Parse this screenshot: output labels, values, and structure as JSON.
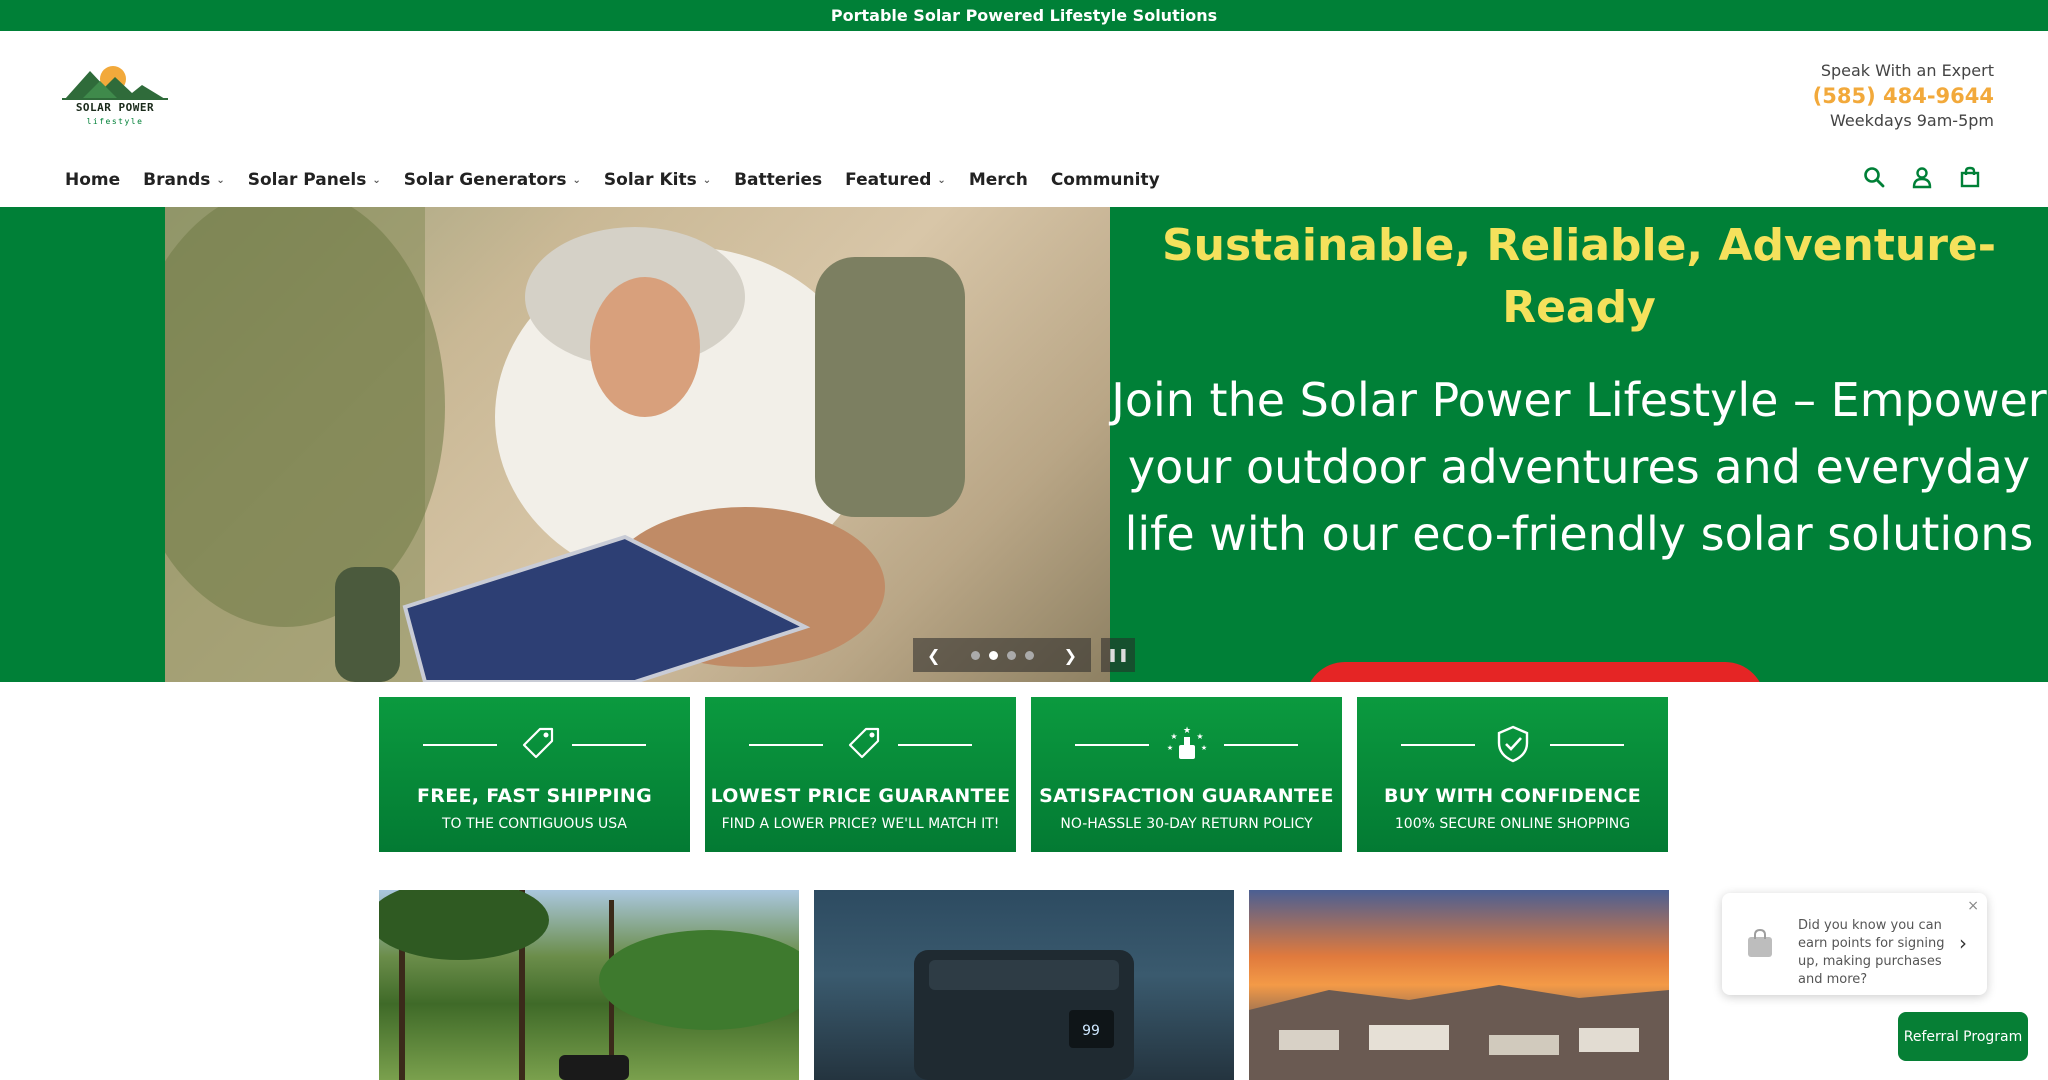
{
  "announcement": {
    "text": "Portable Solar Powered Lifestyle Solutions"
  },
  "logo": {
    "line1": "SOLAR POWER",
    "line2": "lifestyle"
  },
  "contact": {
    "label": "Speak With an Expert",
    "phone": "(585) 484-9644",
    "hours": "Weekdays 9am-5pm"
  },
  "nav": {
    "items": [
      {
        "label": "Home",
        "dropdown": false
      },
      {
        "label": "Brands",
        "dropdown": true
      },
      {
        "label": "Solar Panels",
        "dropdown": true
      },
      {
        "label": "Solar Generators",
        "dropdown": true
      },
      {
        "label": "Solar Kits",
        "dropdown": true
      },
      {
        "label": "Batteries",
        "dropdown": false
      },
      {
        "label": "Featured",
        "dropdown": true
      },
      {
        "label": "Merch",
        "dropdown": false
      },
      {
        "label": "Community",
        "dropdown": false
      }
    ]
  },
  "header_icons": [
    "search-icon",
    "account-icon",
    "cart-icon"
  ],
  "hero": {
    "headline": "Sustainable, Reliable, Adventure-Ready",
    "body": "Join the Solar Power Lifestyle – Empower your outdoor adventures and everyday life with our eco-friendly solar solutions",
    "slides": 4,
    "active_slide": 2
  },
  "badges": [
    {
      "icon": "tag-icon",
      "title": "FREE, FAST SHIPPING",
      "subtitle": "TO THE CONTIGUOUS USA"
    },
    {
      "icon": "tag-icon",
      "title": "LOWEST PRICE GUARANTEE",
      "subtitle": "FIND A LOWER PRICE? WE'LL MATCH IT!"
    },
    {
      "icon": "thumbs-up-stars-icon",
      "title": "SATISFACTION GUARANTEE",
      "subtitle": "NO-HASSLE 30-DAY RETURN POLICY"
    },
    {
      "icon": "shield-check-icon",
      "title": "BUY WITH CONFIDENCE",
      "subtitle": "100% SECURE ONLINE SHOPPING"
    }
  ],
  "popup": {
    "message": "Did you know you can earn points for signing up, making purchases and more?"
  },
  "referral": {
    "label": "Referral Program"
  },
  "colors": {
    "brand_green": "#008037",
    "accent_yellow": "#f5e15c",
    "phone_orange": "#f2a93b",
    "cta_red": "#e52525"
  }
}
